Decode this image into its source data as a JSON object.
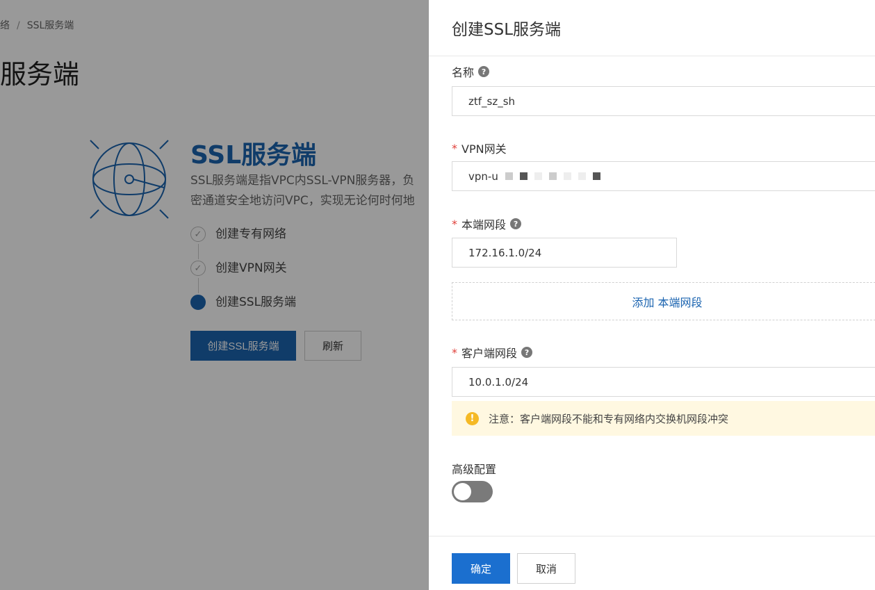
{
  "background": {
    "breadcrumb": [
      "络",
      "SSL服务端"
    ],
    "page_title": "服务端",
    "hero": {
      "title": "SSL服务端",
      "desc_line1": "SSL服务端是指VPC内SSL-VPN服务器，负",
      "desc_line2": "密通道安全地访问VPC，实现无论何时何地"
    },
    "steps": [
      {
        "label": "创建专有网络",
        "state": "done"
      },
      {
        "label": "创建VPN网关",
        "state": "done"
      },
      {
        "label": "创建SSL服务端",
        "state": "current"
      }
    ],
    "create_button": "创建SSL服务端",
    "refresh_button": "刷新"
  },
  "drawer": {
    "title": "创建SSL服务端",
    "name": {
      "label": "名称",
      "value": "ztf_sz_sh"
    },
    "vpn_gateway": {
      "label": "VPN网关",
      "value": "vpn-u"
    },
    "local_cidr": {
      "label": "本端网段",
      "value": "172.16.1.0/24"
    },
    "add_local_cidr": "添加 本端网段",
    "client_cidr": {
      "label": "客户端网段",
      "value": "10.0.1.0/24"
    },
    "warning": "注意：客户端网段不能和专有网络内交换机网段冲突",
    "advanced": {
      "label": "高级配置",
      "enabled": false
    },
    "ok_button": "确定",
    "cancel_button": "取消"
  },
  "icons": {
    "help": "question-circle-icon",
    "warning": "exclamation-circle-icon",
    "globe": "globe-icon",
    "check": "check-circle-icon"
  },
  "colors": {
    "primary": "#1b64b0",
    "primary_button": "#1b6fcf",
    "required": "#e0403a",
    "warning_bg": "#fff8e1",
    "warning_icon": "#f5b925"
  }
}
